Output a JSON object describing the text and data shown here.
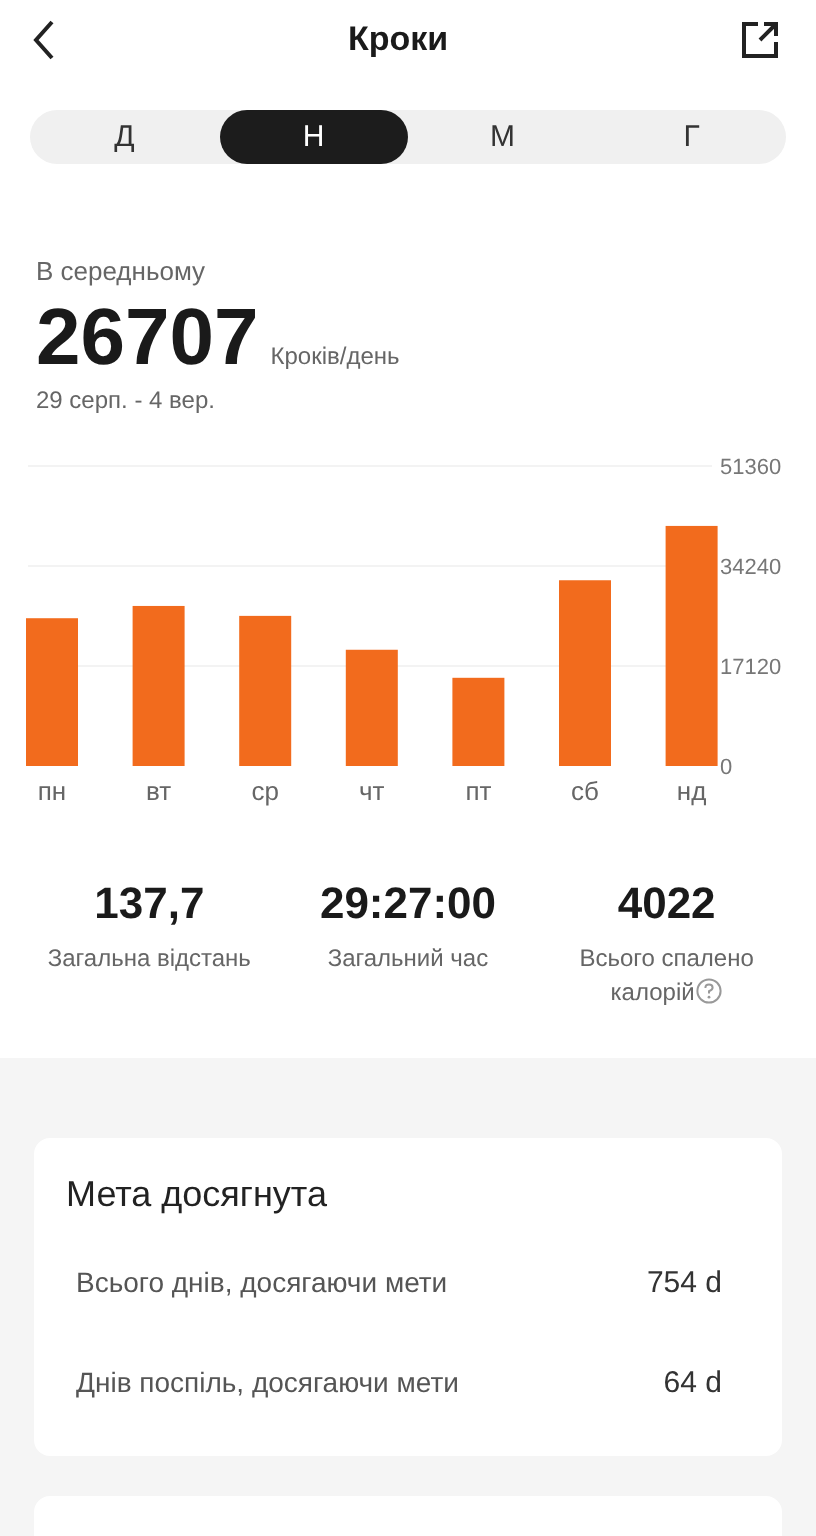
{
  "header": {
    "title": "Кроки"
  },
  "tabs": [
    {
      "label": "Д",
      "selected": false
    },
    {
      "label": "Н",
      "selected": true
    },
    {
      "label": "М",
      "selected": false
    },
    {
      "label": "Г",
      "selected": false
    }
  ],
  "average": {
    "label": "В середньому",
    "value": "26707",
    "unit": "Кроків/день",
    "range": "29 серп. - 4 вер."
  },
  "chart_data": {
    "type": "bar",
    "categories": [
      "пн",
      "вт",
      "ср",
      "чт",
      "пт",
      "сб",
      "нд"
    ],
    "series": [
      {
        "color": "#f26b1d",
        "values": [
          25300,
          27400,
          25700,
          19900,
          15100,
          31800,
          41100
        ]
      }
    ],
    "ylim": [
      0,
      51360
    ],
    "yticks": [
      0,
      17120,
      34240,
      51360
    ]
  },
  "stats": [
    {
      "value": "137,7",
      "label": "Загальна відстань",
      "help": false
    },
    {
      "value": "29:27:00",
      "label": "Загальний час",
      "help": false
    },
    {
      "value": "4022",
      "label": "Всього спалено калорій",
      "help": true
    }
  ],
  "goal_card": {
    "title": "Мета досягнута",
    "rows": [
      {
        "label": "Всього днів, досягаючи мети",
        "value": "754 d"
      },
      {
        "label": "Днів поспіль, досягаючи мети",
        "value": "64 d"
      }
    ]
  }
}
